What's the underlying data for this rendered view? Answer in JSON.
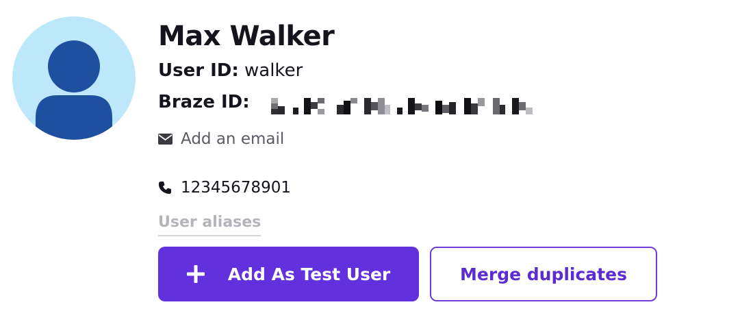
{
  "profile": {
    "name": "Max Walker",
    "user_id_label": "User ID:",
    "user_id_value": "walker",
    "braze_id_label": "Braze ID:",
    "braze_id_value_redacted": true
  },
  "contact": {
    "email_placeholder": "Add an email",
    "phone": "12345678901"
  },
  "aliases_label": "User aliases",
  "actions": {
    "add_test_user_label": "Add As Test User",
    "merge_duplicates_label": "Merge duplicates"
  },
  "icons": {
    "avatar": "user-silhouette-icon",
    "email": "envelope-icon",
    "phone": "phone-icon",
    "add": "plus-icon"
  },
  "colors": {
    "primary": "#6230dd",
    "primary_text": "#ffffff",
    "secondary_border": "#6a3dd8",
    "avatar_bg": "#bde7fa",
    "avatar_figure": "#1f4f9f"
  }
}
